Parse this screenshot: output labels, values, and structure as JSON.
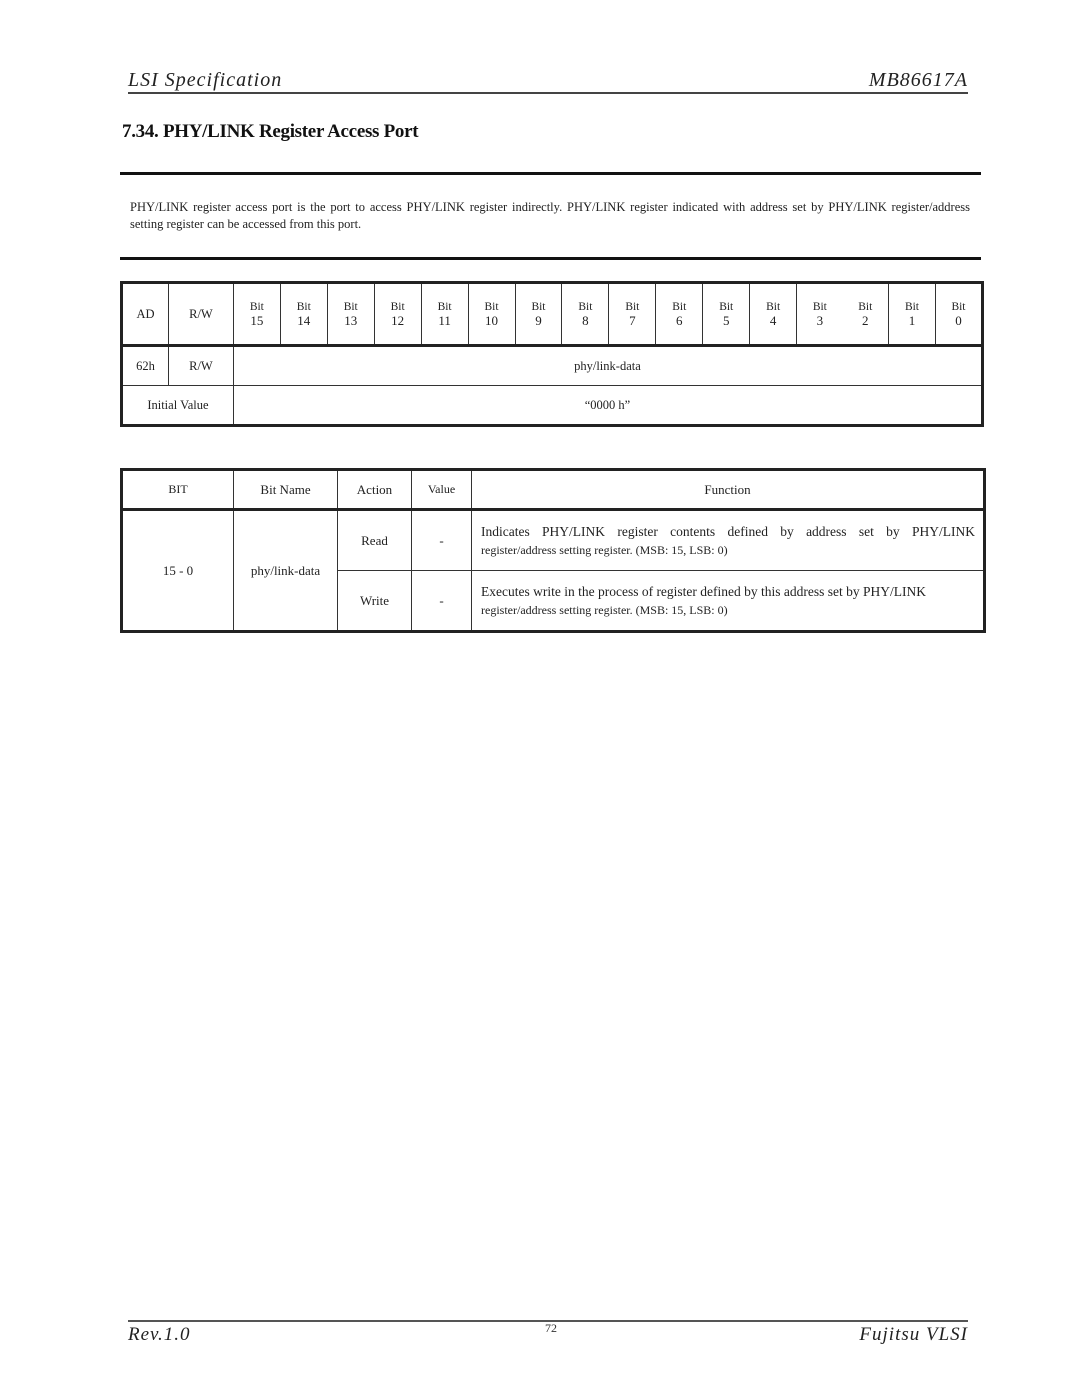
{
  "header": {
    "left": "LSI Specification",
    "right": "MB86617A"
  },
  "section_title": "7.34. PHY/LINK Register Access Port",
  "intro": "PHY/LINK register access port is the port to access PHY/LINK register indirectly.  PHY/LINK register indicated with address set by PHY/LINK register/address setting register can be accessed from this port.",
  "register_table": {
    "headers": {
      "ad": "AD",
      "rw": "R/W",
      "bit_label": "Bit"
    },
    "bits": [
      "15",
      "14",
      "13",
      "12",
      "11",
      "10",
      "9",
      "8",
      "7",
      "6",
      "5",
      "4",
      "3",
      "2",
      "1",
      "0"
    ],
    "row": {
      "ad": "62h",
      "rw": "R/W",
      "field": "phy/link-data"
    },
    "initial": {
      "label": "Initial Value",
      "value": "“0000 h”"
    }
  },
  "bit_table": {
    "headers": {
      "bit": "BIT",
      "name": "Bit Name",
      "action": "Action",
      "value": "Value",
      "function": "Function"
    },
    "rows": [
      {
        "bit": "15 - 0",
        "name": "phy/link-data",
        "actions": [
          {
            "action": "Read",
            "value": "-",
            "function_l1": "Indicates PHY/LINK register contents defined by address set by PHY/LINK",
            "function_l2": "register/address setting register.  (MSB: 15, LSB: 0)"
          },
          {
            "action": "Write",
            "value": "-",
            "function_l1": "Executes write in the process of register defined by this address set by PHY/LINK",
            "function_l2": "register/address setting register.  (MSB: 15, LSB: 0)"
          }
        ]
      }
    ]
  },
  "footer": {
    "left": "Rev.1.0",
    "page": "72",
    "right": "Fujitsu VLSI"
  }
}
